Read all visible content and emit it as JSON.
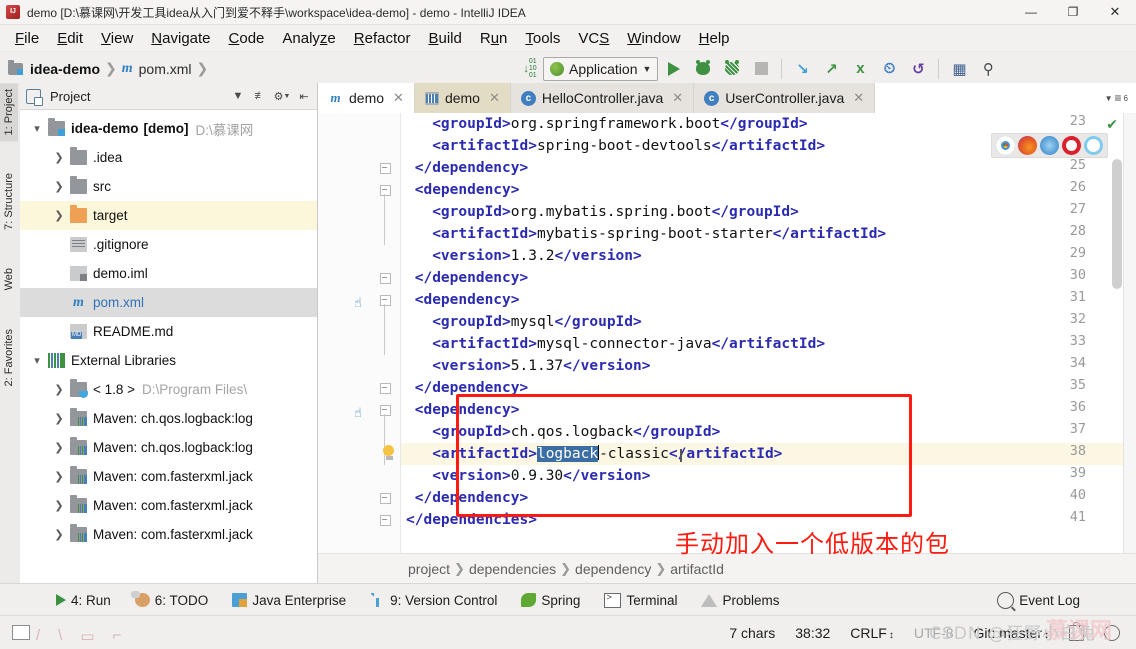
{
  "window": {
    "title": "demo [D:\\慕课网\\开发工具idea从入门到爱不释手\\workspace\\idea-demo] - demo - IntelliJ IDEA",
    "app_icon": "intellij-idea-icon",
    "minimize": "—",
    "maximize": "❐",
    "close": "✕"
  },
  "menu": [
    {
      "label": "File",
      "accel": "F"
    },
    {
      "label": "Edit",
      "accel": "E"
    },
    {
      "label": "View",
      "accel": "V"
    },
    {
      "label": "Navigate",
      "accel": "N"
    },
    {
      "label": "Code",
      "accel": "C"
    },
    {
      "label": "Analyze",
      "accel": "z"
    },
    {
      "label": "Refactor",
      "accel": "R"
    },
    {
      "label": "Build",
      "accel": "B"
    },
    {
      "label": "Run",
      "accel": "u"
    },
    {
      "label": "Tools",
      "accel": "T"
    },
    {
      "label": "VCS",
      "accel": "S"
    },
    {
      "label": "Window",
      "accel": "W"
    },
    {
      "label": "Help",
      "accel": "H"
    }
  ],
  "toolbar": {
    "breadcrumb": [
      "idea-demo",
      "pom.xml"
    ],
    "run_config": "Application",
    "icons": [
      "sort-icon",
      "run-icon",
      "debug-icon",
      "run-coverage-icon",
      "stop-icon",
      "update-project-icon",
      "commit-icon",
      "vcs-branch-icon",
      "history-icon",
      "undo-icon",
      "project-structure-icon",
      "search-everywhere-icon"
    ]
  },
  "left_strip": [
    {
      "label": "1: Project",
      "icon": "project-icon",
      "selected": true
    },
    {
      "label": "7: Structure",
      "icon": "structure-icon",
      "selected": false
    },
    {
      "label": "Web",
      "icon": "web-icon",
      "selected": false
    },
    {
      "label": "2: Favorites",
      "icon": "favorites-star-icon",
      "selected": false
    }
  ],
  "project_panel": {
    "title": "Project",
    "header_icons": [
      "chevron-down-icon",
      "collapse-all-icon",
      "settings-gear-icon",
      "hide-panel-icon"
    ],
    "tree": [
      {
        "label": "idea-demo",
        "bold_suffix": "[demo]",
        "dim": "D:\\慕课网",
        "icon": "module-folder-icon",
        "arrow": "expanded",
        "indent": 0,
        "highlight": "none"
      },
      {
        "label": ".idea",
        "icon": "folder-icon",
        "arrow": "collapsed",
        "indent": 1,
        "highlight": "none"
      },
      {
        "label": "src",
        "icon": "folder-icon",
        "arrow": "collapsed",
        "indent": 1,
        "highlight": "none"
      },
      {
        "label": "target",
        "icon": "folder-orange-icon",
        "arrow": "collapsed",
        "indent": 1,
        "highlight": "yellow"
      },
      {
        "label": ".gitignore",
        "icon": "file-icon",
        "arrow": "none",
        "indent": 1,
        "highlight": "none"
      },
      {
        "label": "demo.iml",
        "icon": "iml-file-icon",
        "arrow": "none",
        "indent": 1,
        "highlight": "none"
      },
      {
        "label": "pom.xml",
        "icon": "maven-m-icon",
        "arrow": "none",
        "indent": 1,
        "highlight": "grey"
      },
      {
        "label": "README.md",
        "icon": "markdown-file-icon",
        "arrow": "none",
        "indent": 1,
        "highlight": "none"
      },
      {
        "label": "External Libraries",
        "icon": "library-icon",
        "arrow": "expanded",
        "indent": 0,
        "highlight": "none"
      },
      {
        "label": "< 1.8 >",
        "dim": "D:\\Program Files\\",
        "icon": "jdk-icon",
        "arrow": "collapsed",
        "indent": 1,
        "highlight": "none"
      },
      {
        "label": "Maven: ch.qos.logback:log",
        "icon": "maven-lib-icon",
        "arrow": "collapsed",
        "indent": 1,
        "highlight": "none"
      },
      {
        "label": "Maven: ch.qos.logback:log",
        "icon": "maven-lib-icon",
        "arrow": "collapsed",
        "indent": 1,
        "highlight": "none"
      },
      {
        "label": "Maven: com.fasterxml.jack",
        "icon": "maven-lib-icon",
        "arrow": "collapsed",
        "indent": 1,
        "highlight": "none"
      },
      {
        "label": "Maven: com.fasterxml.jack",
        "icon": "maven-lib-icon",
        "arrow": "collapsed",
        "indent": 1,
        "highlight": "none"
      },
      {
        "label": "Maven: com.fasterxml.jack",
        "icon": "maven-lib-icon",
        "arrow": "collapsed",
        "indent": 1,
        "highlight": "none"
      }
    ]
  },
  "editor": {
    "tabs": [
      {
        "label": "demo",
        "icon": "maven-m-icon",
        "state": "active"
      },
      {
        "label": "demo",
        "icon": "maven-project-icon",
        "state": "selected"
      },
      {
        "label": "HelloController.java",
        "icon": "java-class-icon",
        "state": "normal"
      },
      {
        "label": "UserController.java",
        "icon": "java-class-icon",
        "state": "normal"
      }
    ],
    "tabs_right_icon": "tab-list-icon",
    "tabs_right_count": "6",
    "first_line_number": 23,
    "lines": [
      {
        "n": 23,
        "indent": 8,
        "text": "<groupId>org.springframework.boot</groupId>"
      },
      {
        "n": 24,
        "indent": 8,
        "text": "<artifactId>spring-boot-devtools</artifactId>"
      },
      {
        "n": 25,
        "indent": 4,
        "text": "</dependency>"
      },
      {
        "n": 26,
        "indent": 4,
        "text": "<dependency>"
      },
      {
        "n": 27,
        "indent": 8,
        "text": "<groupId>org.mybatis.spring.boot</groupId>"
      },
      {
        "n": 28,
        "indent": 8,
        "text": "<artifactId>mybatis-spring-boot-starter</artifactId>"
      },
      {
        "n": 29,
        "indent": 8,
        "text": "<version>1.3.2</version>"
      },
      {
        "n": 30,
        "indent": 4,
        "text": "</dependency>"
      },
      {
        "n": 31,
        "indent": 4,
        "text": "<dependency>"
      },
      {
        "n": 32,
        "indent": 8,
        "text": "<groupId>mysql</groupId>"
      },
      {
        "n": 33,
        "indent": 8,
        "text": "<artifactId>mysql-connector-java</artifactId>"
      },
      {
        "n": 34,
        "indent": 8,
        "text": "<version>5.1.37</version>"
      },
      {
        "n": 35,
        "indent": 4,
        "text": "</dependency>"
      },
      {
        "n": 36,
        "indent": 4,
        "text": "<dependency>"
      },
      {
        "n": 37,
        "indent": 8,
        "text": "<groupId>ch.qos.logback</groupId>"
      },
      {
        "n": 38,
        "indent": 8,
        "text": "<artifactId>logback-classic</artifactId>",
        "selection": "logback",
        "current": true
      },
      {
        "n": 39,
        "indent": 8,
        "text": "<version>0.9.30</version>"
      },
      {
        "n": 40,
        "indent": 4,
        "text": "</dependency>"
      },
      {
        "n": 41,
        "indent": 2,
        "text": "</dependencies>"
      }
    ],
    "browser_icons": [
      "chrome-icon",
      "firefox-icon",
      "safari-icon",
      "opera-icon",
      "edge-icon"
    ],
    "inspection_status": "✔",
    "breadcrumb": [
      "project",
      "dependencies",
      "dependency",
      "artifactId"
    ],
    "annotation_note": "手动加入一个低版本的包",
    "annotation_color": "#ff1b0f"
  },
  "bottom_bar": [
    {
      "label": "4: Run",
      "accel": "4",
      "icon": "run-icon"
    },
    {
      "label": "6: TODO",
      "accel": "6",
      "icon": "todo-icon"
    },
    {
      "label": "Java Enterprise",
      "accel": "",
      "icon": "java-enterprise-icon"
    },
    {
      "label": "9: Version Control",
      "accel": "9",
      "icon": "version-control-icon"
    },
    {
      "label": "Spring",
      "accel": "",
      "icon": "spring-leaf-icon"
    },
    {
      "label": "Terminal",
      "accel": "",
      "icon": "terminal-icon"
    },
    {
      "label": "Problems",
      "accel": "",
      "icon": "problems-icon"
    },
    {
      "label": "Event Log",
      "accel": "",
      "icon": "event-log-icon"
    }
  ],
  "status_bar": {
    "chars": "7 chars",
    "caret": "38:32",
    "line_separator": "CRLF",
    "encoding": "UTF-8",
    "branch": "Git: master",
    "lock_icon": "read-only-lock-icon",
    "smiley_icon": "highlight-level-icon",
    "left_icon": "toggle-toolbar-icon"
  },
  "watermark": {
    "csdn": "CSDN @狂野小白兔",
    "site": "慕课网"
  }
}
